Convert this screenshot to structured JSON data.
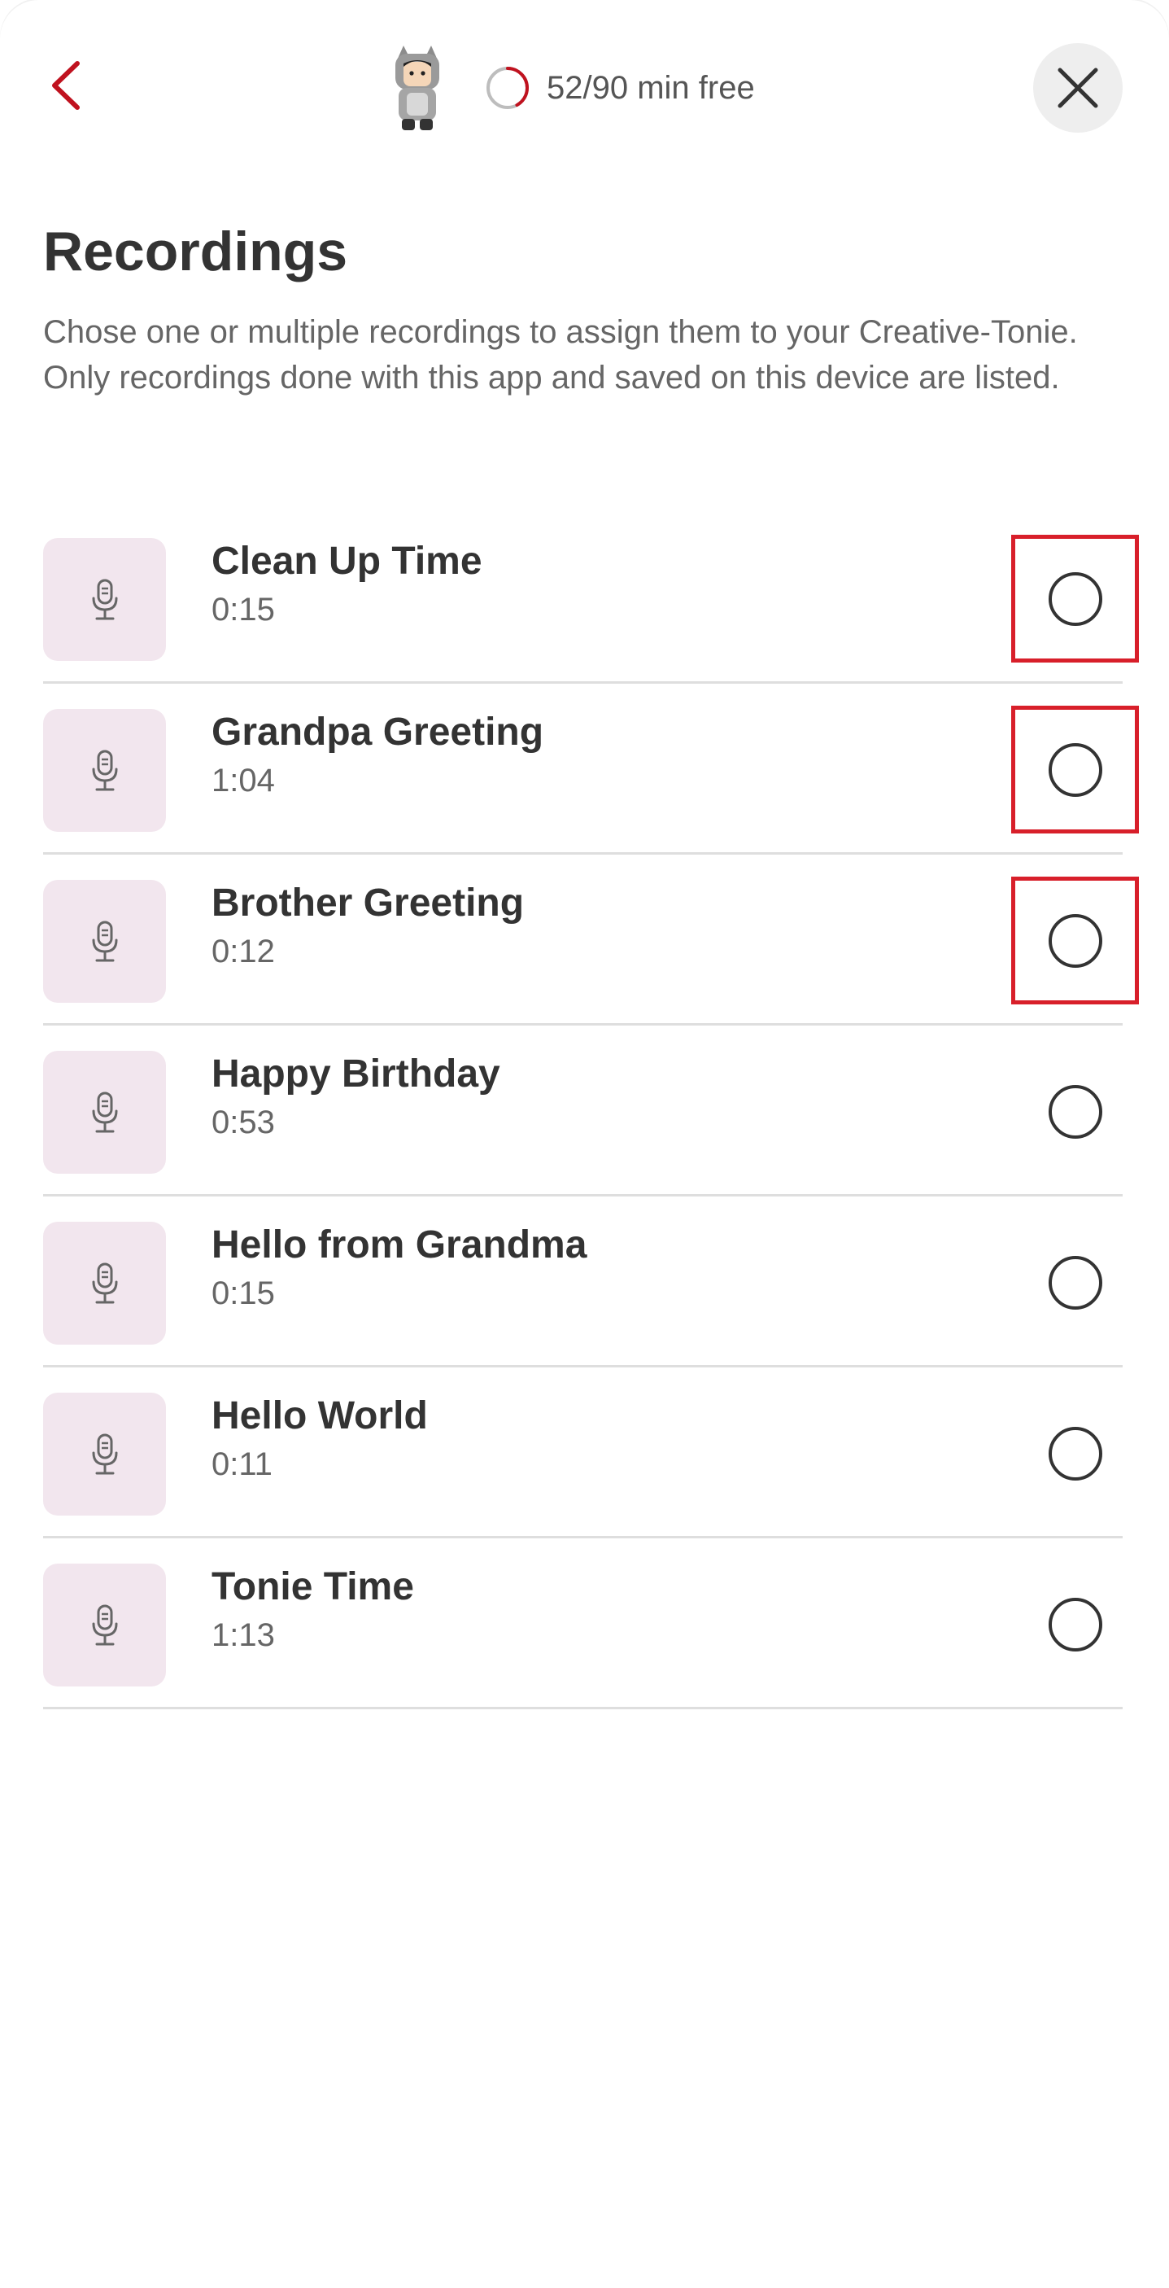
{
  "header": {
    "capacity_text": "52/90 min free",
    "capacity_used_fraction": 0.42,
    "accent_color": "#c0121f",
    "back_icon": "chevron-left-icon",
    "close_icon": "close-icon",
    "figure_icon": "tonie-figure-icon"
  },
  "page": {
    "title": "Recordings",
    "description": "Chose one or multiple recordings to assign them to your Creative-Tonie. Only recordings done with this app and saved on this device are listed."
  },
  "recordings": [
    {
      "title": "Clean Up Time",
      "duration": "0:15",
      "selected": false,
      "highlighted": true,
      "icon": "microphone-icon"
    },
    {
      "title": "Grandpa Greeting",
      "duration": "1:04",
      "selected": false,
      "highlighted": true,
      "icon": "microphone-icon"
    },
    {
      "title": "Brother Greeting",
      "duration": "0:12",
      "selected": false,
      "highlighted": true,
      "icon": "microphone-icon"
    },
    {
      "title": "Happy Birthday",
      "duration": "0:53",
      "selected": false,
      "highlighted": false,
      "icon": "microphone-icon"
    },
    {
      "title": "Hello from Grandma",
      "duration": "0:15",
      "selected": false,
      "highlighted": false,
      "icon": "microphone-icon"
    },
    {
      "title": "Hello World",
      "duration": "0:11",
      "selected": false,
      "highlighted": false,
      "icon": "microphone-icon"
    },
    {
      "title": "Tonie Time",
      "duration": "1:13",
      "selected": false,
      "highlighted": false,
      "icon": "microphone-icon"
    }
  ],
  "colors": {
    "highlight_border": "#d81f2a",
    "icon_tile_bg": "#f2e6ee",
    "divider": "#dedede"
  }
}
